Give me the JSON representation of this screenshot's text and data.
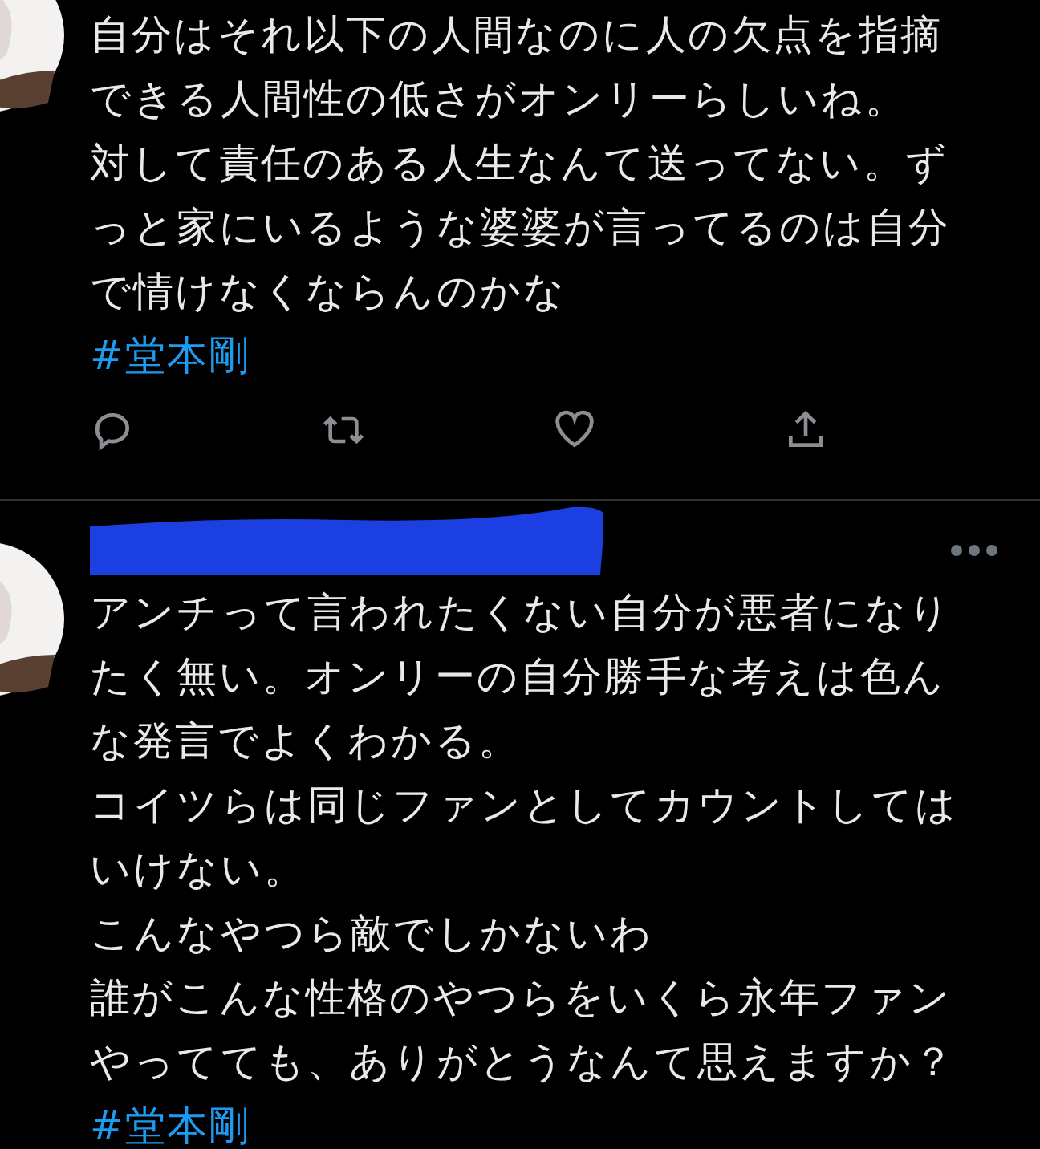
{
  "tweets": [
    {
      "redacted_header": false,
      "action_bar": true,
      "lines": [
        "自分はそれ以下の人間なのに人の欠点を指摘",
        "できる人間性の低さがオンリーらしいね。",
        "対して責任のある人生なんて送ってない。ず",
        "っと家にいるような婆婆が言ってるのは自分",
        "で情けなくならんのかな"
      ],
      "hashtag": "#堂本剛"
    },
    {
      "redacted_header": true,
      "action_bar": false,
      "lines": [
        "アンチって言われたくない自分が悪者になり",
        "たく無い。オンリーの自分勝手な考えは色ん",
        "な発言でよくわかる。",
        "コイツらは同じファンとしてカウントしては",
        "いけない。",
        "こんなやつら敵でしかないわ",
        "誰がこんな性格のやつらをいくら永年ファン",
        "やってても、ありがとうなんて思えますか？"
      ],
      "hashtag": "#堂本剛"
    }
  ]
}
